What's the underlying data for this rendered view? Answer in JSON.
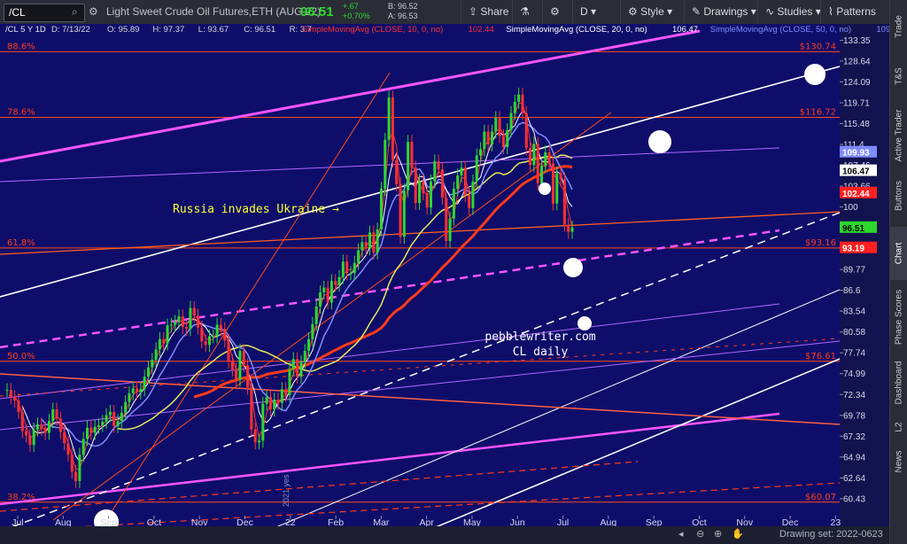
{
  "toolbar": {
    "symbol": "/CL",
    "instrument": "Light Sweet Crude Oil Futures,ETH (AUG 22)",
    "last_price": "96.51",
    "change": "+.67",
    "change_pct": "+0.70%",
    "bid": "B: 96.52",
    "ask": "A: 96.53",
    "share": "Share",
    "style": "Style",
    "drawings": "Drawings",
    "studies": "Studies",
    "patterns": "Patterns",
    "d": "D"
  },
  "side_tabs": [
    "Trade",
    "T&S",
    "Active Trader",
    "Buttons",
    "Chart",
    "Phase Scores",
    "Dashboard",
    "L2",
    "News"
  ],
  "bottom": {
    "drawing_set": "Drawing set: 2022-0623"
  },
  "colors": {
    "bg": "#0e0e6a",
    "white": "#ffffff",
    "magenta": "#ff55ff",
    "red": "#ff3a2a",
    "orange": "#ff5f1f",
    "yellow": "#e8e85a",
    "blue": "#6f7fff",
    "fib": "#ff4a1a",
    "violet": "#b266ff"
  },
  "chart_data": {
    "type": "line",
    "header": {
      "symbol_info": "/CL 5 Y 1D",
      "ohlc": [
        "D: 7/13/22",
        "O: 95.89",
        "H: 97.37",
        "L: 93.67",
        "C: 96.51",
        "R: 3.7"
      ],
      "studies": [
        {
          "label": "SimpleMovingAvg (CLOSE, 10, 0, no)",
          "value": "102.44",
          "color": "#ff3030"
        },
        {
          "label": "SimpleMovingAvg (CLOSE, 20, 0, no)",
          "value": "106.47",
          "color": "#ffffff"
        },
        {
          "label": "SimpleMovingAvg (CLOSE, 50, 0, no)",
          "value": "109.93",
          "color": "#7f8cff"
        }
      ]
    },
    "price_axis": {
      "ylim": [
        59.5,
        135.5
      ],
      "ticks": [
        "133.35",
        "128.64",
        "124.09",
        "119.71",
        "115.48",
        "111.4",
        "107.46",
        "103.66",
        "100",
        "96.51",
        "93.19",
        "89.77",
        "86.6",
        "83.54",
        "80.58",
        "77.74",
        "74.99",
        "72.34",
        "69.78",
        "67.32",
        "64.94",
        "62.64",
        "60.43"
      ],
      "scale": "log"
    },
    "time_axis": {
      "labels": [
        "Jul",
        "Aug",
        "Sep",
        "Oct",
        "Nov",
        "Dec",
        "22",
        "Feb",
        "Mar",
        "Apr",
        "May",
        "Jun",
        "Jul",
        "Aug",
        "Sep",
        "Oct",
        "Nov",
        "Dec",
        "23"
      ]
    },
    "price_labels": [
      {
        "text": "109.93",
        "value": 109.93,
        "color": "#7f8cff"
      },
      {
        "text": "106.47",
        "value": 106.47,
        "color": "#ffffff"
      },
      {
        "text": "102.44",
        "value": 102.44,
        "color": "#ff2020"
      },
      {
        "text": "96.51",
        "value": 96.51,
        "color": "#2bd82b"
      },
      {
        "text": "93.19",
        "value": 93.19,
        "color": "#ff2020"
      }
    ],
    "fib_levels": [
      {
        "pct": "88.6%",
        "value": 130.74,
        "label": "$130.74"
      },
      {
        "pct": "78.6%",
        "value": 116.72,
        "label": "$116.72"
      },
      {
        "pct": "61.8%",
        "value": 93.16,
        "label": "$93.16"
      },
      {
        "pct": "50.0%",
        "value": 76.61,
        "label": "$76.61"
      },
      {
        "pct": "38.2%",
        "value": 60.07,
        "label": "$60.07"
      }
    ],
    "annotations": [
      {
        "text": "Russia invades Ukraine →",
        "color": "#ffff33"
      },
      {
        "text": "pebblewriter.com",
        "color": "#ffffff"
      },
      {
        "text": "CL daily",
        "color": "#ffffff"
      }
    ],
    "vertical_label": "2021 yes",
    "closes": [
      72.9,
      72.0,
      71.6,
      70.2,
      67.9,
      67.4,
      66.3,
      68.1,
      68.7,
      68.2,
      67.7,
      69.1,
      70.5,
      69.4,
      67.8,
      66.5,
      65.2,
      63.3,
      62.3,
      65.2,
      67.0,
      68.3,
      67.7,
      68.4,
      68.6,
      69.0,
      69.8,
      70.2,
      68.5,
      69.1,
      70.1,
      71.4,
      72.5,
      73.1,
      72.6,
      73.0,
      74.6,
      75.8,
      76.8,
      78.2,
      79.6,
      79.0,
      81.5,
      81.6,
      82.0,
      82.8,
      81.3,
      81.0,
      84.0,
      82.9,
      81.2,
      79.3,
      78.8,
      80.0,
      80.0,
      81.6,
      81.0,
      79.4,
      76.6,
      75.5,
      74.2,
      78.0,
      76.1,
      73.2,
      68.1,
      66.6,
      66.8,
      71.2,
      72.0,
      70.5,
      71.7,
      71.3,
      73.0,
      72.3,
      75.6,
      76.9,
      74.6,
      76.5,
      78.0,
      79.6,
      81.7,
      84.2,
      86.3,
      87.0,
      84.8,
      88.0,
      87.4,
      88.6,
      91.0,
      89.2,
      89.2,
      90.8,
      92.8,
      94.1,
      93.1,
      95.7,
      92.4,
      96.2,
      103.2,
      112.3,
      120.8,
      108.4,
      104.0,
      95.0,
      102.9,
      111.9,
      107.0,
      100.7,
      104.6,
      102.4,
      99.9,
      104.5,
      108.2,
      106.7,
      101.6,
      94.3,
      98.0,
      103.2,
      105.6,
      107.0,
      102.1,
      99.8,
      104.5,
      109.3,
      110.5,
      113.9,
      111.4,
      113.9,
      116.6,
      113.0,
      110.9,
      114.2,
      117.6,
      119.9,
      121.4,
      117.6,
      110.7,
      107.5,
      111.5,
      104.2,
      107.4,
      109.9,
      107.8,
      100.6,
      106.0,
      104.9,
      97.0,
      95.8,
      96.5
    ]
  }
}
